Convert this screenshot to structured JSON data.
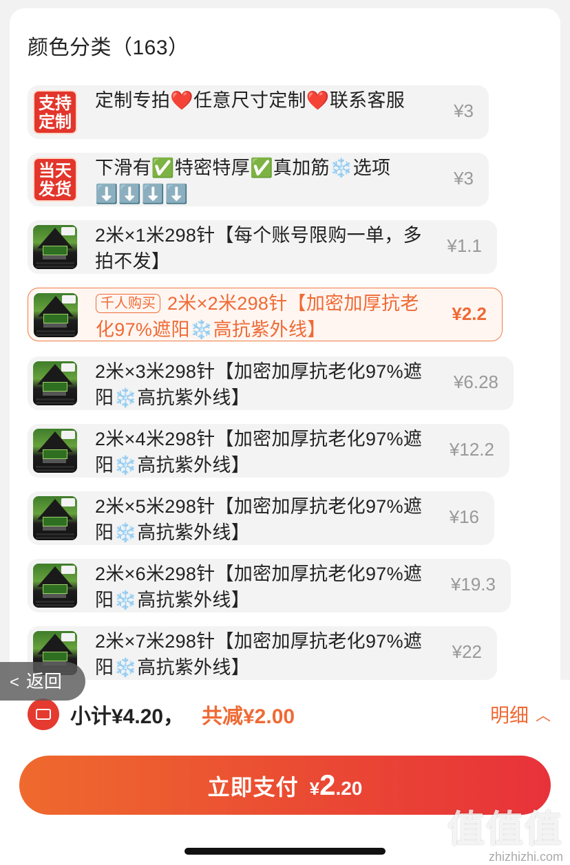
{
  "section": {
    "title": "颜色分类（163）"
  },
  "options": [
    {
      "thumb_type": "badge",
      "badge": "支持定制",
      "label": "定制专拍❤️任意尺寸定制❤️联系客服",
      "price": "¥3",
      "selected": false
    },
    {
      "thumb_type": "badge",
      "badge": "当天发货",
      "label": "下滑有✅特密特厚✅真加筋❄️选项⬇️⬇️⬇️⬇️",
      "price": "¥3",
      "selected": false
    },
    {
      "thumb_type": "product",
      "label": "2米×1米298针【每个账号限购一单，多拍不发】",
      "price": "¥1.1",
      "selected": false
    },
    {
      "thumb_type": "product",
      "tag": "千人购买",
      "label": "2米×2米298针【加密加厚抗老化97%遮阳❄️高抗紫外线】",
      "price": "¥2.2",
      "selected": true
    },
    {
      "thumb_type": "product",
      "label": "2米×3米298针【加密加厚抗老化97%遮阳❄️高抗紫外线】",
      "price": "¥6.28",
      "selected": false
    },
    {
      "thumb_type": "product",
      "label": "2米×4米298针【加密加厚抗老化97%遮阳❄️高抗紫外线】",
      "price": "¥12.2",
      "selected": false
    },
    {
      "thumb_type": "product",
      "label": "2米×5米298针【加密加厚抗老化97%遮阳❄️高抗紫外线】",
      "price": "¥16",
      "selected": false
    },
    {
      "thumb_type": "product",
      "label": "2米×6米298针【加密加厚抗老化97%遮阳❄️高抗紫外线】",
      "price": "¥19.3",
      "selected": false
    },
    {
      "thumb_type": "product",
      "label": "2米×7米298针【加密加厚抗老化97%遮阳❄️高抗紫外线】",
      "price": "¥22",
      "selected": false
    }
  ],
  "back": {
    "label": "返回"
  },
  "summary": {
    "subtotal": "小计¥4.20，",
    "discount": "共减¥2.00",
    "detail": "明细"
  },
  "pay": {
    "label": "立即支付",
    "currency": "¥",
    "amount_int": "2",
    "amount_dec": ".20"
  },
  "watermark": {
    "mark": "值值值",
    "domain": "zhizhizhi.com"
  },
  "colors": {
    "accent": "#ef6a35",
    "badge_red": "#e2352b",
    "pay_gradient_end": "#e8323a"
  }
}
